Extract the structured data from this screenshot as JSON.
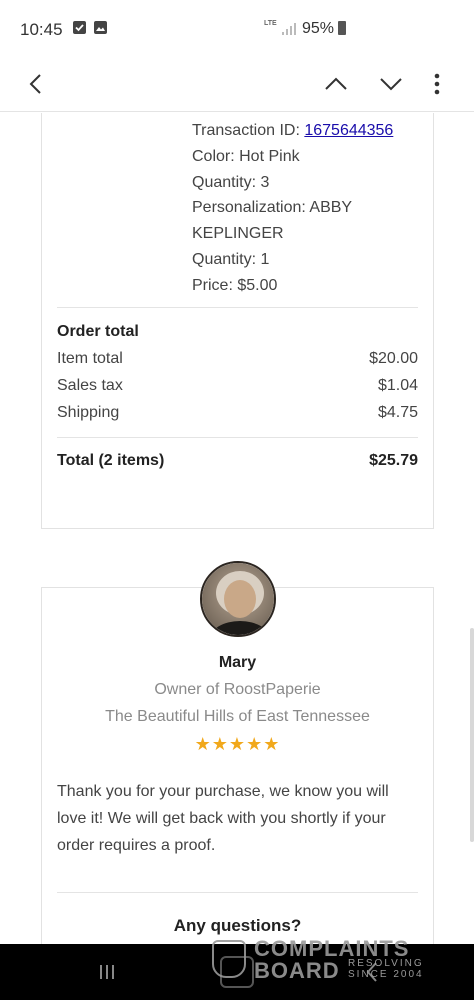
{
  "status_bar": {
    "time": "10:45",
    "network": "LTE",
    "battery": "95%"
  },
  "order": {
    "transaction_label": "Transaction ID:",
    "transaction_id": "1675644356",
    "color": "Color: Hot Pink",
    "quantity_1": "Quantity: 3",
    "personalization_line1": "Personalization: ABBY",
    "personalization_line2": "KEPLINGER",
    "quantity_2": "Quantity: 1",
    "price": "Price: $5.00"
  },
  "totals": {
    "heading": "Order total",
    "item_total_label": "Item total",
    "item_total_value": "$20.00",
    "sales_tax_label": "Sales tax",
    "sales_tax_value": "$1.04",
    "shipping_label": "Shipping",
    "shipping_value": "$4.75",
    "total_label": "Total (2 items)",
    "total_value": "$25.79"
  },
  "seller": {
    "name": "Mary",
    "role": "Owner of RoostPaperie",
    "location": "The Beautiful Hills of East Tennessee",
    "rating": "★★★★★",
    "rating_value": 5,
    "message": "Thank you for your purchase, we know you will love it! We will get back with you shortly if your order requires a proof.",
    "questions_heading": "Any questions?"
  },
  "watermark": {
    "line1": "COMPLAINTS",
    "line2": "BOARD",
    "tag1": "RESOLVING",
    "tag2": "SINCE 2004"
  },
  "colors": {
    "link": "#1a0dab",
    "stars": "#f1a81b",
    "muted_text": "#8a8a8a",
    "nav_bar": "#000000"
  },
  "icons": [
    "check-icon",
    "gallery-icon",
    "signal-icon",
    "battery-icon",
    "back-arrow-icon",
    "chevron-up-icon",
    "chevron-down-icon",
    "more-vert-icon",
    "recents-icon",
    "home-icon",
    "back-icon"
  ]
}
